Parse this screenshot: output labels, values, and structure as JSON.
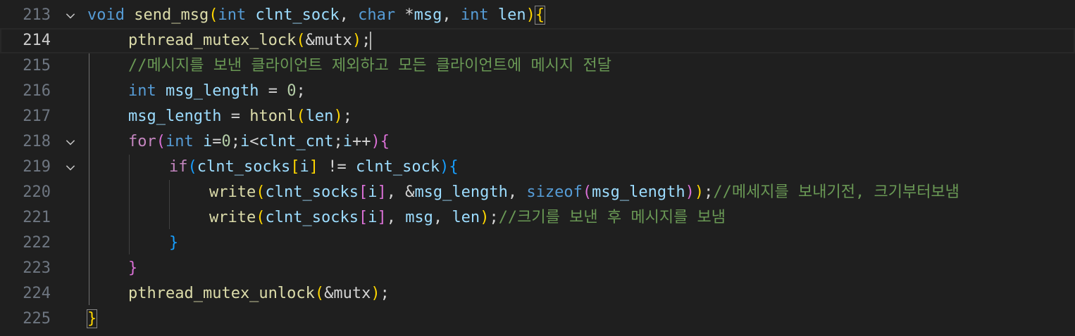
{
  "editor": {
    "lines": [
      {
        "num": "213",
        "tokens": [
          [
            "void",
            "k-blue"
          ],
          [
            " ",
            "plain"
          ],
          [
            "send_msg",
            "fn"
          ],
          [
            "(",
            "b1"
          ],
          [
            "int",
            "k-blue"
          ],
          [
            " ",
            "plain"
          ],
          [
            "clnt_sock",
            "var"
          ],
          [
            ", ",
            "plain"
          ],
          [
            "char",
            "k-blue"
          ],
          [
            " *",
            "plain"
          ],
          [
            "msg",
            "var"
          ],
          [
            ", ",
            "plain"
          ],
          [
            "int",
            "k-blue"
          ],
          [
            " ",
            "plain"
          ],
          [
            "len",
            "var"
          ],
          [
            ")",
            "b1"
          ],
          [
            "{",
            "b1"
          ]
        ]
      },
      {
        "num": "214",
        "tokens": [
          [
            "pthread_mutex_lock",
            "fn"
          ],
          [
            "(",
            "b1"
          ],
          [
            "&mutx",
            "plain"
          ],
          [
            ")",
            "b1"
          ],
          [
            ";",
            "plain"
          ]
        ]
      },
      {
        "num": "215",
        "tokens": [
          [
            "//메시지를 보낸 클라이언트 제외하고 모든 클라이언트에 메시지 전달",
            "cm"
          ]
        ]
      },
      {
        "num": "216",
        "tokens": [
          [
            "int",
            "k-blue"
          ],
          [
            " ",
            "plain"
          ],
          [
            "msg_length",
            "var"
          ],
          [
            " = ",
            "plain"
          ],
          [
            "0",
            "num"
          ],
          [
            ";",
            "plain"
          ]
        ]
      },
      {
        "num": "217",
        "tokens": [
          [
            "msg_length",
            "var"
          ],
          [
            " = ",
            "plain"
          ],
          [
            "htonl",
            "fn"
          ],
          [
            "(",
            "b1"
          ],
          [
            "len",
            "var"
          ],
          [
            ")",
            "b1"
          ],
          [
            ";",
            "plain"
          ]
        ]
      },
      {
        "num": "218",
        "tokens": [
          [
            "for",
            "k-purple"
          ],
          [
            "(",
            "b2"
          ],
          [
            "int",
            "k-blue"
          ],
          [
            " ",
            "plain"
          ],
          [
            "i",
            "var"
          ],
          [
            "=",
            "plain"
          ],
          [
            "0",
            "num"
          ],
          [
            ";",
            "plain"
          ],
          [
            "i",
            "var"
          ],
          [
            "<",
            "plain"
          ],
          [
            "clnt_cnt",
            "var"
          ],
          [
            ";",
            "plain"
          ],
          [
            "i",
            "var"
          ],
          [
            "++",
            "plain"
          ],
          [
            ")",
            "b2"
          ],
          [
            "{",
            "b2"
          ]
        ]
      },
      {
        "num": "219",
        "tokens": [
          [
            "if",
            "k-purple"
          ],
          [
            "(",
            "b3"
          ],
          [
            "clnt_socks",
            "var"
          ],
          [
            "[",
            "b1"
          ],
          [
            "i",
            "var"
          ],
          [
            "]",
            "b1"
          ],
          [
            " != ",
            "plain"
          ],
          [
            "clnt_sock",
            "var"
          ],
          [
            ")",
            "b3"
          ],
          [
            "{",
            "b3"
          ]
        ]
      },
      {
        "num": "220",
        "tokens": [
          [
            "write",
            "fn"
          ],
          [
            "(",
            "b1"
          ],
          [
            "clnt_socks",
            "var"
          ],
          [
            "[",
            "b2"
          ],
          [
            "i",
            "var"
          ],
          [
            "]",
            "b2"
          ],
          [
            ", &",
            "plain"
          ],
          [
            "msg_length",
            "var"
          ],
          [
            ", ",
            "plain"
          ],
          [
            "sizeof",
            "k-blue"
          ],
          [
            "(",
            "b2"
          ],
          [
            "msg_length",
            "var"
          ],
          [
            ")",
            "b2"
          ],
          [
            ")",
            "b1"
          ],
          [
            ";",
            "plain"
          ],
          [
            "//메세지를 보내기전, 크기부터보냄",
            "cm"
          ]
        ]
      },
      {
        "num": "221",
        "tokens": [
          [
            "write",
            "fn"
          ],
          [
            "(",
            "b1"
          ],
          [
            "clnt_socks",
            "var"
          ],
          [
            "[",
            "b2"
          ],
          [
            "i",
            "var"
          ],
          [
            "]",
            "b2"
          ],
          [
            ", ",
            "plain"
          ],
          [
            "msg",
            "var"
          ],
          [
            ", ",
            "plain"
          ],
          [
            "len",
            "var"
          ],
          [
            ")",
            "b1"
          ],
          [
            ";",
            "plain"
          ],
          [
            "//크기를 보낸 후 메시지를 보냄",
            "cm"
          ]
        ]
      },
      {
        "num": "222",
        "tokens": [
          [
            "}",
            "b3"
          ]
        ]
      },
      {
        "num": "223",
        "tokens": [
          [
            "}",
            "b2"
          ]
        ]
      },
      {
        "num": "224",
        "tokens": [
          [
            "pthread_mutex_unlock",
            "fn"
          ],
          [
            "(",
            "b1"
          ],
          [
            "&mutx",
            "plain"
          ],
          [
            ")",
            "b1"
          ],
          [
            ";",
            "plain"
          ]
        ]
      },
      {
        "num": "225",
        "tokens": [
          [
            "}",
            "b1"
          ]
        ]
      }
    ]
  }
}
